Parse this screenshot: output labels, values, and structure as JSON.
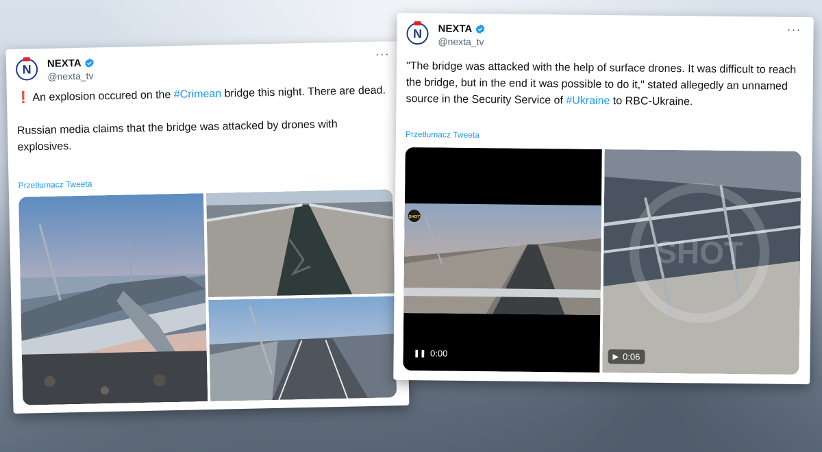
{
  "left_tweet": {
    "author": "NEXTA",
    "handle": "@nexta_tv",
    "more": "···",
    "line1_prefix": "❗ An explosion occured on the ",
    "line1_hashtag": "#Crimean",
    "line1_suffix": " bridge this night. There are dead.",
    "line2": "Russian media claims that the bridge was attacked by drones with explosives.",
    "translate": "Przetłumacz Tweeta"
  },
  "right_tweet": {
    "author": "NEXTA",
    "handle": "@nexta_tv",
    "more": "···",
    "text_prefix": "\"The bridge was attacked with the help of surface drones. It was difficult to reach the bridge, but in the end it was possible to do it,\" stated allegedly an unnamed source in the Security Service of ",
    "text_hashtag": "#Ukraine",
    "text_suffix": " to RBC-Ukraine.",
    "translate": "Przetłumacz Tweeta",
    "video1_time": "0:00",
    "video2_time": "0:06"
  },
  "colors": {
    "link": "#1d9bf0",
    "verified": "#1d9bf0",
    "avatar": "#1d3a8a"
  }
}
